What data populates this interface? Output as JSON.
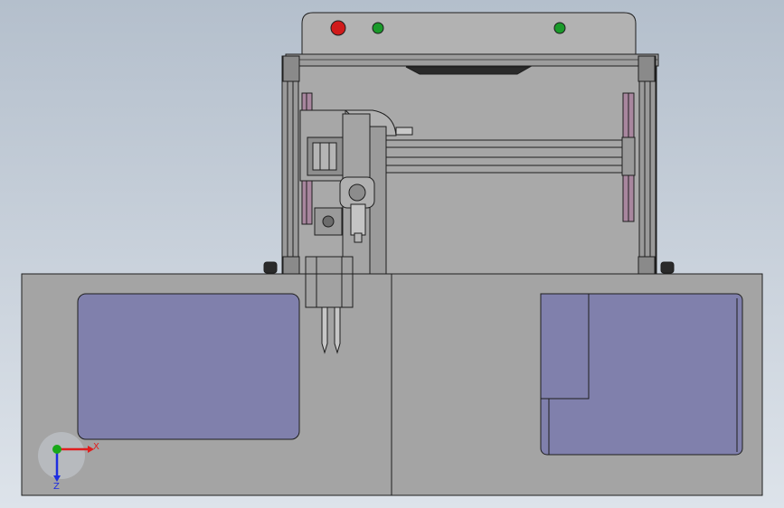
{
  "viewport": {
    "background_top": "#b4bfcc",
    "background_bottom": "#dde3ea"
  },
  "triad": {
    "x_label": "X",
    "z_label": "Z",
    "x_color": "#e01e1e",
    "y_color": "#18a818",
    "z_color": "#1e2ee0"
  },
  "control_panel": {
    "indicators": [
      {
        "name": "red-indicator-light",
        "color": "#d01a1a"
      },
      {
        "name": "green-indicator-light-left",
        "color": "#1a9a2a"
      },
      {
        "name": "green-indicator-light-right",
        "color": "#1a9a2a"
      }
    ]
  },
  "colors": {
    "metal": "#a8a8a8",
    "metal_dark": "#8e8e8e",
    "outline": "#1e1e1e",
    "tray": "#8080ac",
    "rail_accent": "#a8869e",
    "base": "#a4a4a4"
  }
}
